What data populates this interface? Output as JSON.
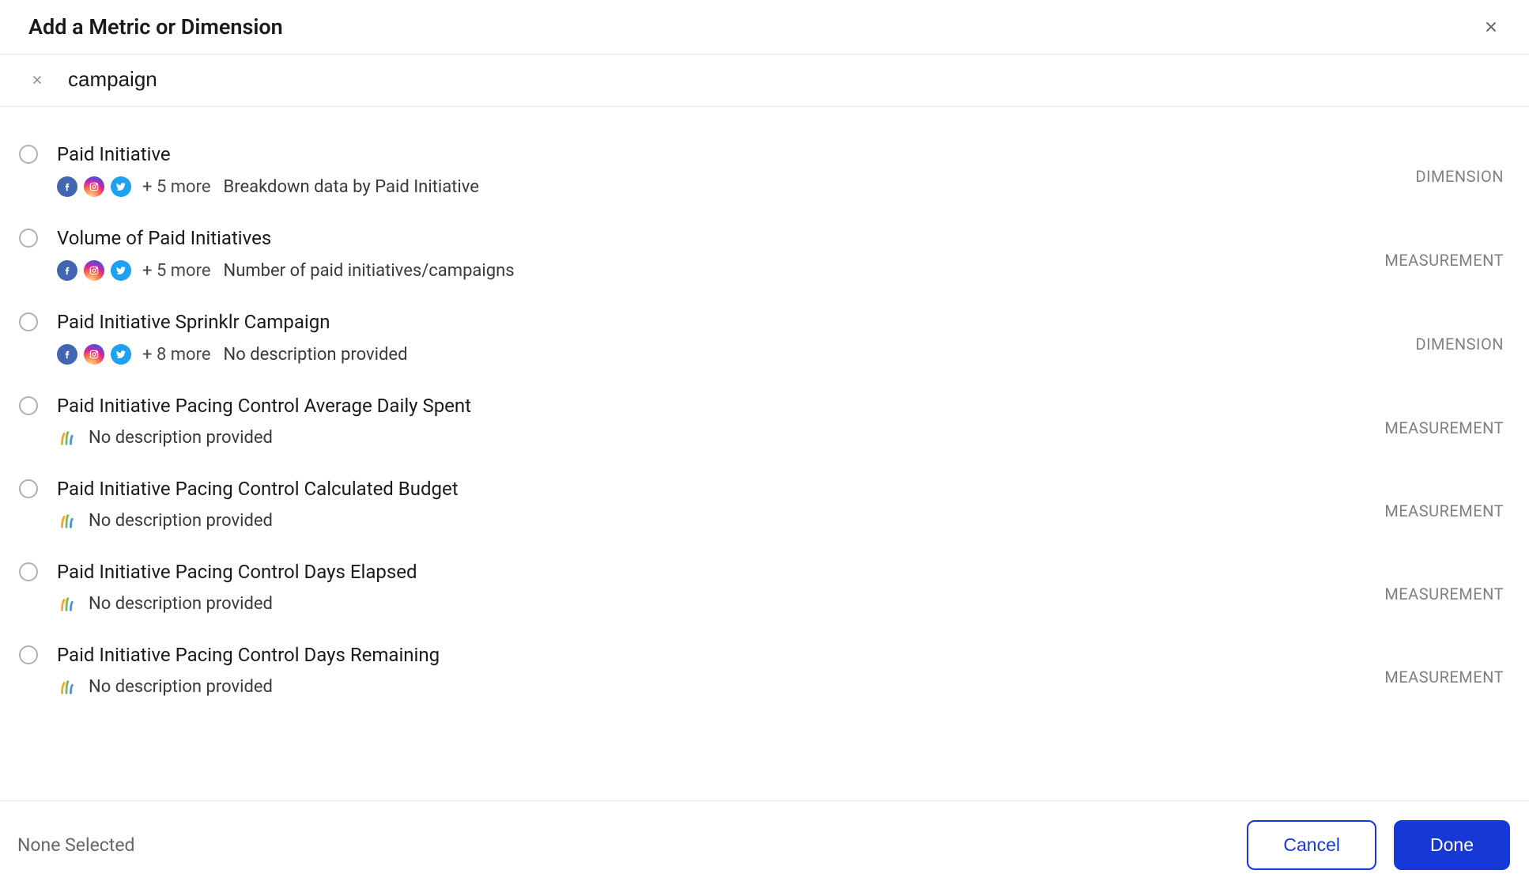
{
  "header": {
    "title": "Add a Metric or Dimension"
  },
  "search": {
    "value": "campaign"
  },
  "items": [
    {
      "title": "Paid Initiative",
      "icons": "social",
      "more": "+ 5 more",
      "desc": "Breakdown data by Paid Initiative",
      "type": "DIMENSION"
    },
    {
      "title": "Volume of Paid Initiatives",
      "icons": "social",
      "more": "+ 5 more",
      "desc": "Number of paid initiatives/campaigns",
      "type": "MEASUREMENT"
    },
    {
      "title": "Paid Initiative Sprinklr Campaign",
      "icons": "social",
      "more": "+ 8 more",
      "desc": "No description provided",
      "type": "DIMENSION"
    },
    {
      "title": "Paid Initiative Pacing Control Average Daily Spent",
      "icons": "sprinklr",
      "more": "",
      "desc": "No description provided",
      "type": "MEASUREMENT"
    },
    {
      "title": "Paid Initiative Pacing Control Calculated Budget",
      "icons": "sprinklr",
      "more": "",
      "desc": "No description provided",
      "type": "MEASUREMENT"
    },
    {
      "title": "Paid Initiative Pacing Control Days Elapsed",
      "icons": "sprinklr",
      "more": "",
      "desc": "No description provided",
      "type": "MEASUREMENT"
    },
    {
      "title": "Paid Initiative Pacing Control Days Remaining",
      "icons": "sprinklr",
      "more": "",
      "desc": "No description provided",
      "type": "MEASUREMENT"
    }
  ],
  "footer": {
    "status": "None Selected",
    "cancel": "Cancel",
    "done": "Done"
  }
}
